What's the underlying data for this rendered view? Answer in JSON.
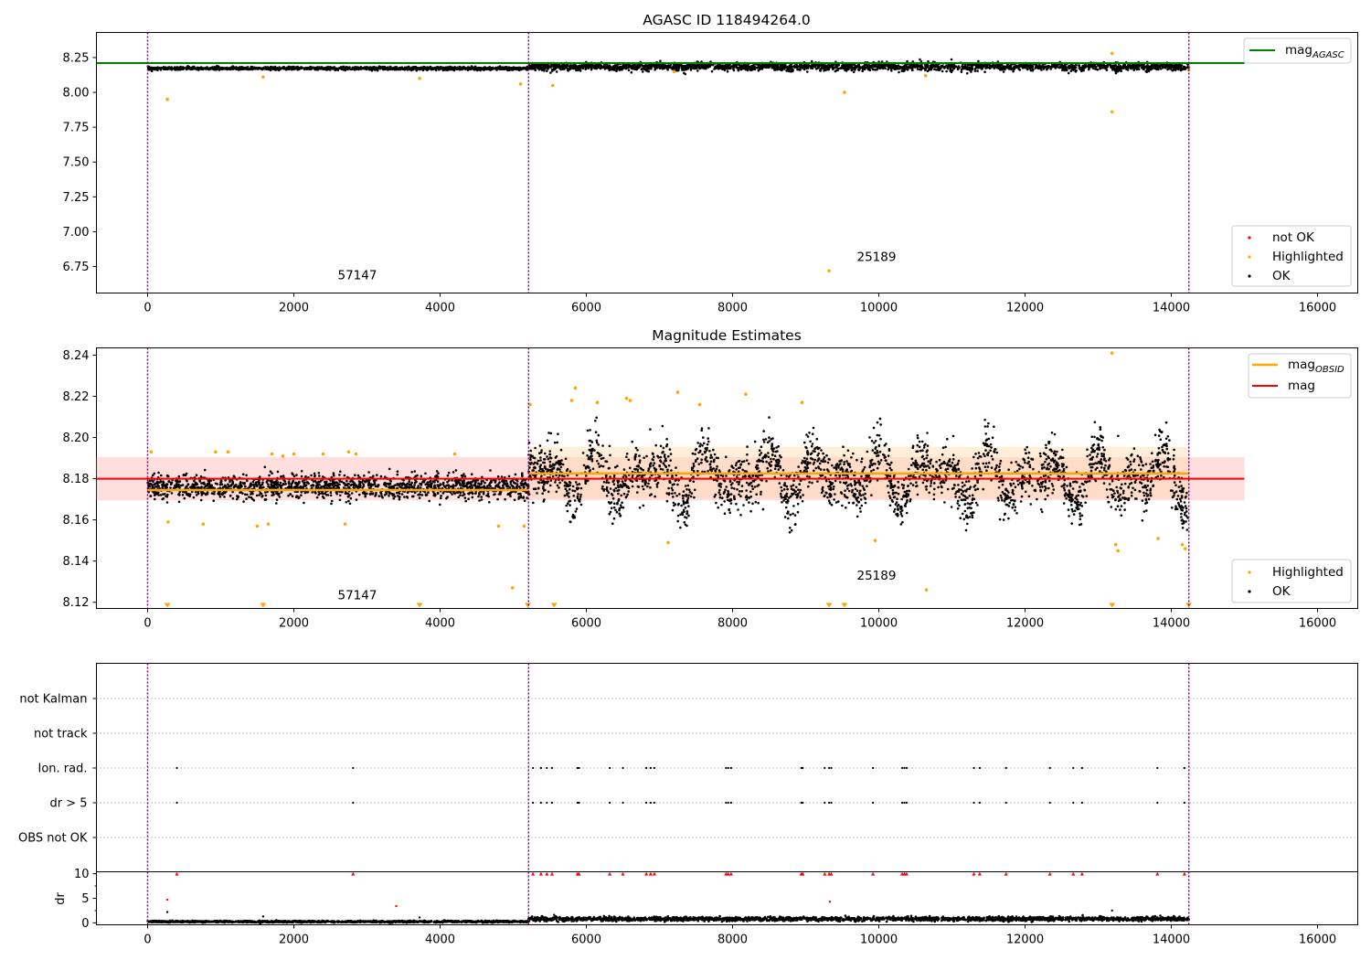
{
  "colors": {
    "ok": "#000000",
    "highlighted": "#ffa500",
    "not_ok": "#ff0000",
    "mag_agasc": "#008000",
    "mag_obsid": "#ffa500",
    "mag": "#ff0000",
    "obs_boundary": "#800080",
    "band_mag": "#ffb0b0",
    "band_obsid": "#ffd8a8"
  },
  "chart_data": [
    {
      "type": "scatter",
      "title": "AGASC ID 118494264.0",
      "xlim": [
        -700,
        16550
      ],
      "ylim": [
        6.56,
        8.43
      ],
      "xticks": [
        "0",
        "2000",
        "4000",
        "6000",
        "8000",
        "10000",
        "12000",
        "14000",
        "16000"
      ],
      "yticks": [
        "6.75",
        "7.00",
        "7.25",
        "7.50",
        "7.75",
        "8.00",
        "8.25"
      ],
      "obs_boundaries": [
        0,
        5210,
        14240
      ],
      "obsids": [
        {
          "label": "57147",
          "x": 2600,
          "y": 6.66
        },
        {
          "label": "25189",
          "x": 9700,
          "y": 6.79
        }
      ],
      "hlines": [
        {
          "name": "mag_AGASC",
          "y": 8.21,
          "x": [
            -700,
            15000
          ],
          "color": "mag_agasc"
        }
      ],
      "series": [
        {
          "name": "OK",
          "segments": [
            {
              "x": [
                0,
                5210
              ],
              "center": 8.172,
              "spread": 0.012
            },
            {
              "x": [
                5210,
                14240
              ],
              "center": 8.184,
              "spread": 0.03
            }
          ]
        },
        {
          "name": "Highlighted",
          "points": [
            [
              270,
              7.95
            ],
            [
              1580,
              8.11
            ],
            [
              3720,
              8.1
            ],
            [
              5100,
              8.06
            ],
            [
              5540,
              8.05
            ],
            [
              7200,
              8.15
            ],
            [
              9320,
              6.72
            ],
            [
              9530,
              8.0
            ],
            [
              10640,
              8.12
            ],
            [
              13190,
              8.28
            ],
            [
              13190,
              7.86
            ],
            [
              14240,
              8.16
            ]
          ]
        },
        {
          "name": "not OK",
          "points": []
        }
      ],
      "legends": [
        {
          "position": "top-right",
          "entries": [
            {
              "label": "mag",
              "subscript": "AGASC"
            }
          ]
        },
        {
          "position": "lower-right",
          "entries": [
            {
              "label": "not OK"
            },
            {
              "label": "Highlighted"
            },
            {
              "label": "OK"
            }
          ]
        }
      ]
    },
    {
      "type": "scatter",
      "title": "Magnitude Estimates",
      "xlim": [
        -700,
        16550
      ],
      "ylim": [
        8.117,
        8.2435
      ],
      "xticks": [
        "0",
        "2000",
        "4000",
        "6000",
        "8000",
        "10000",
        "12000",
        "14000",
        "16000"
      ],
      "yticks": [
        "8.12",
        "8.14",
        "8.16",
        "8.18",
        "8.20",
        "8.22",
        "8.24"
      ],
      "obs_boundaries": [
        0,
        5210,
        14240
      ],
      "obsids": [
        {
          "label": "57147",
          "x": 2600,
          "y": 8.1215
        },
        {
          "label": "25189",
          "x": 9700,
          "y": 8.131
        }
      ],
      "bands": [
        {
          "name": "mag",
          "x": [
            -700,
            15000
          ],
          "y": [
            8.1695,
            8.1905
          ],
          "color": "band_mag"
        },
        {
          "name": "mag_OBSID",
          "x": [
            5210,
            14240
          ],
          "y": [
            8.1705,
            8.1955
          ],
          "color": "band_obsid"
        }
      ],
      "hlines": [
        {
          "name": "mag_OBSID",
          "y": 8.1745,
          "x": [
            0,
            5210
          ],
          "color": "mag_obsid"
        },
        {
          "name": "mag_OBSID",
          "y": 8.1825,
          "x": [
            5210,
            14240
          ],
          "color": "mag_obsid"
        },
        {
          "name": "mag",
          "y": 8.18,
          "x": [
            -700,
            15000
          ],
          "color": "mag"
        }
      ],
      "series": [
        {
          "name": "OK",
          "segments": [
            {
              "x": [
                0,
                5210
              ],
              "center": 8.176,
              "spread": 0.0065
            },
            {
              "x": [
                5210,
                14240
              ],
              "center": 8.181,
              "spread": 0.014
            }
          ]
        },
        {
          "name": "Highlighted",
          "points": [
            [
              50,
              8.193
            ],
            [
              280,
              8.159
            ],
            [
              760,
              8.158
            ],
            [
              930,
              8.193
            ],
            [
              1100,
              8.193
            ],
            [
              1500,
              8.157
            ],
            [
              1650,
              8.158
            ],
            [
              1700,
              8.192
            ],
            [
              1850,
              8.191
            ],
            [
              2000,
              8.192
            ],
            [
              2400,
              8.192
            ],
            [
              2700,
              8.158
            ],
            [
              2750,
              8.193
            ],
            [
              2850,
              8.192
            ],
            [
              4200,
              8.192
            ],
            [
              4800,
              8.157
            ],
            [
              4990,
              8.127
            ],
            [
              5150,
              8.157
            ],
            [
              5230,
              8.216
            ],
            [
              5800,
              8.218
            ],
            [
              5850,
              8.224
            ],
            [
              6150,
              8.217
            ],
            [
              6550,
              8.219
            ],
            [
              6600,
              8.218
            ],
            [
              7120,
              8.149
            ],
            [
              7250,
              8.222
            ],
            [
              7550,
              8.216
            ],
            [
              8180,
              8.221
            ],
            [
              8950,
              8.217
            ],
            [
              9950,
              8.15
            ],
            [
              10650,
              8.126
            ],
            [
              13190,
              8.241
            ],
            [
              13240,
              8.148
            ],
            [
              13270,
              8.145
            ],
            [
              13820,
              8.151
            ],
            [
              14150,
              8.148
            ],
            [
              14190,
              8.146
            ]
          ]
        }
      ],
      "off_scale_low": [
        270,
        1580,
        3720,
        5200,
        5560,
        9320,
        9530,
        13190,
        14240
      ],
      "legends": [
        {
          "position": "top-right",
          "entries": [
            {
              "label": "mag",
              "subscript": "OBSID"
            },
            {
              "label": "mag"
            }
          ]
        },
        {
          "position": "lower-right",
          "entries": [
            {
              "label": "Highlighted"
            },
            {
              "label": "OK"
            }
          ]
        }
      ]
    },
    {
      "type": "scatter",
      "title": "",
      "xlim": [
        -700,
        16550
      ],
      "xticks": [],
      "categories": [
        "not Kalman",
        "not track",
        "Ion. rad.",
        "dr > 5",
        "OBS not OK"
      ],
      "obs_boundaries": [
        0,
        5210,
        14240
      ],
      "flag_times": [
        400,
        2810,
        5270,
        5380,
        5460,
        5530,
        5880,
        5900,
        6320,
        6500,
        6820,
        6880,
        6930,
        7910,
        7940,
        7980,
        8940,
        8960,
        9260,
        9320,
        9350,
        9920,
        10320,
        10350,
        10380,
        11300,
        11380,
        11740,
        12340,
        12660,
        12780,
        13810,
        14180
      ],
      "flags_present": {
        "Ion. rad.": true,
        "dr > 5": true
      }
    },
    {
      "type": "scatter",
      "title": "",
      "ylabel": "dr",
      "xlim": [
        -700,
        16550
      ],
      "ylim": [
        -0.4,
        10.4
      ],
      "xticks": [
        "0",
        "2000",
        "4000",
        "6000",
        "8000",
        "10000",
        "12000",
        "14000",
        "16000"
      ],
      "yticks": [
        "0",
        "5",
        "10"
      ],
      "obs_boundaries": [
        0,
        5210,
        14240
      ],
      "series": [
        {
          "name": "OK",
          "segments": [
            {
              "x": [
                0,
                5210
              ],
              "center": 0.25,
              "spread": 0.2
            },
            {
              "x": [
                5210,
                14240
              ],
              "center": 0.8,
              "spread": 0.45
            }
          ],
          "extra_points": [
            [
              270,
              2.2
            ],
            [
              1580,
              1.3
            ],
            [
              3720,
              1.1
            ],
            [
              5560,
              1.6
            ],
            [
              13190,
              2.5
            ]
          ]
        },
        {
          "name": "not OK",
          "points": [
            [
              270,
              4.7
            ],
            [
              3400,
              3.4
            ],
            [
              9330,
              4.3
            ]
          ]
        }
      ],
      "capped_at": 10
    }
  ]
}
